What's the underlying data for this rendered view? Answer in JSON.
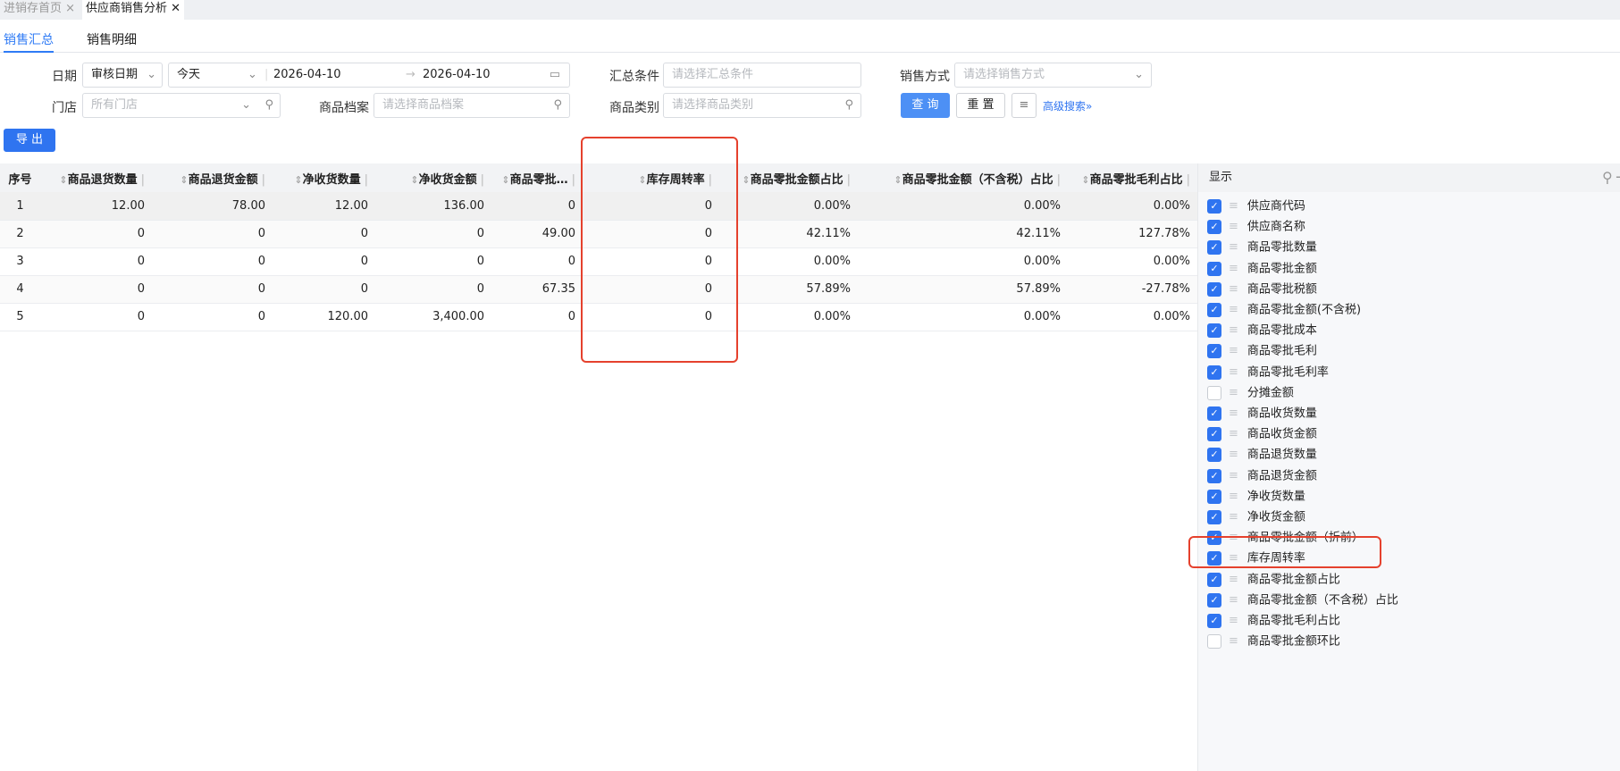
{
  "tabs": [
    {
      "label": "进销存首页",
      "close": "×"
    },
    {
      "label": "供应商销售分析",
      "close": "✕"
    }
  ],
  "subtabs": [
    "销售汇总",
    "销售明细"
  ],
  "filters": {
    "date_label": "日期",
    "date_type": "审核日期",
    "date_range_preset": "今天",
    "start_date": "2026-04-10",
    "end_date": "2026-04-10",
    "summary_label": "汇总条件",
    "summary_placeholder": "请选择汇总条件",
    "sales_mode_label": "销售方式",
    "sales_mode_placeholder": "请选择销售方式",
    "store_label": "门店",
    "store_placeholder": "所有门店",
    "product_label": "商品档案",
    "product_placeholder": "请选择商品档案",
    "category_label": "商品类别",
    "category_placeholder": "请选择商品类别",
    "query": "查 询",
    "reset": "重 置",
    "advanced": "高级搜索"
  },
  "export": "导 出",
  "table": {
    "headers": [
      "序号",
      "商品退货数量",
      "商品退货金额",
      "净收货数量",
      "净收货金额",
      "商品零批…",
      "库存周转率",
      "商品零批金额占比",
      "商品零批金额（不含税）占比",
      "商品零批毛利占比"
    ],
    "rows": [
      [
        "1",
        "12.00",
        "78.00",
        "12.00",
        "136.00",
        "0",
        "0",
        "0.00%",
        "0.00%",
        "0.00%"
      ],
      [
        "2",
        "0",
        "0",
        "0",
        "0",
        "49.00",
        "0",
        "42.11%",
        "42.11%",
        "127.78%"
      ],
      [
        "3",
        "0",
        "0",
        "0",
        "0",
        "0",
        "0",
        "0.00%",
        "0.00%",
        "0.00%"
      ],
      [
        "4",
        "0",
        "0",
        "0",
        "0",
        "67.35",
        "0",
        "57.89%",
        "57.89%",
        "-27.78%"
      ],
      [
        "5",
        "0",
        "0",
        "120.00",
        "3,400.00",
        "0",
        "0",
        "0.00%",
        "0.00%",
        "0.00%"
      ]
    ]
  },
  "column_panel": {
    "title": "显示",
    "items": [
      {
        "label": "供应商代码",
        "checked": true
      },
      {
        "label": "供应商名称",
        "checked": true
      },
      {
        "label": "商品零批数量",
        "checked": true
      },
      {
        "label": "商品零批金额",
        "checked": true
      },
      {
        "label": "商品零批税额",
        "checked": true
      },
      {
        "label": "商品零批金额(不含税)",
        "checked": true
      },
      {
        "label": "商品零批成本",
        "checked": true
      },
      {
        "label": "商品零批毛利",
        "checked": true
      },
      {
        "label": "商品零批毛利率",
        "checked": true
      },
      {
        "label": "分摊金额",
        "checked": false
      },
      {
        "label": "商品收货数量",
        "checked": true
      },
      {
        "label": "商品收货金额",
        "checked": true
      },
      {
        "label": "商品退货数量",
        "checked": true
      },
      {
        "label": "商品退货金额",
        "checked": true
      },
      {
        "label": "净收货数量",
        "checked": true
      },
      {
        "label": "净收货金额",
        "checked": true
      },
      {
        "label": "商品零批金额（折前）",
        "checked": true
      },
      {
        "label": "库存周转率",
        "checked": true
      },
      {
        "label": "商品零批金额占比",
        "checked": true
      },
      {
        "label": "商品零批金额（不含税）占比",
        "checked": true
      },
      {
        "label": "商品零批毛利占比",
        "checked": true
      },
      {
        "label": "商品零批金额环比",
        "checked": false
      }
    ]
  }
}
